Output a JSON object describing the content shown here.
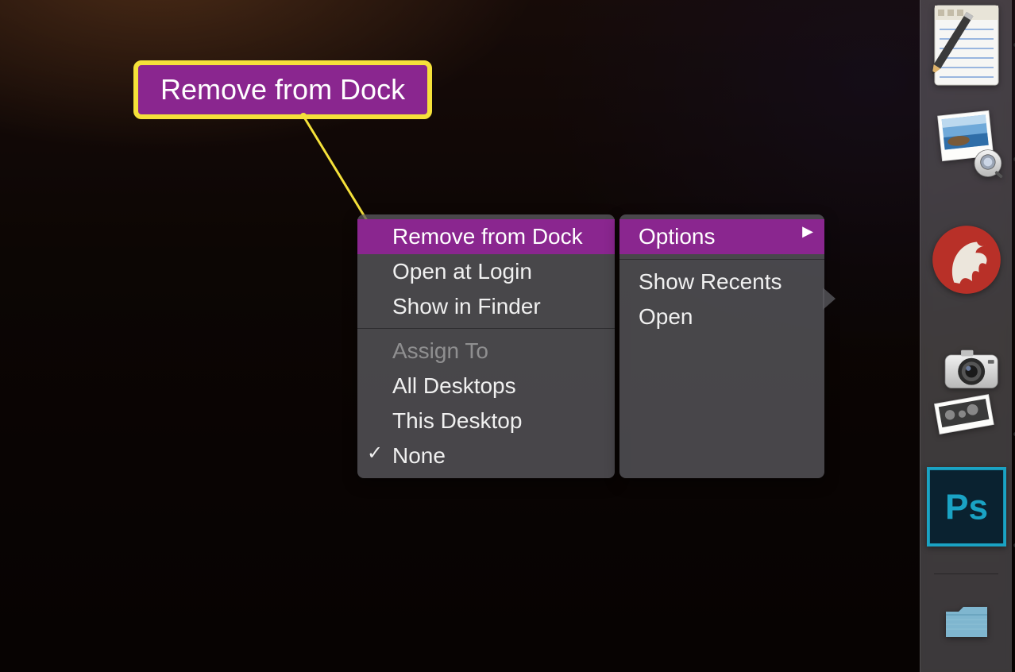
{
  "callout": {
    "label": "Remove from Dock"
  },
  "context_menu": {
    "level1": {
      "options_label": "Options",
      "items": [
        {
          "label": "Show Recents"
        },
        {
          "label": "Open"
        }
      ]
    },
    "level2": {
      "section1": [
        {
          "label": "Remove from Dock",
          "highlighted": true
        },
        {
          "label": "Open at Login"
        },
        {
          "label": "Show in Finder"
        }
      ],
      "section2_header": "Assign To",
      "section2": [
        {
          "label": "All Desktops"
        },
        {
          "label": "This Desktop"
        },
        {
          "label": "None",
          "checked": true
        }
      ]
    }
  },
  "dock": {
    "items": [
      {
        "name": "textedit-icon"
      },
      {
        "name": "preview-icon"
      },
      {
        "name": "bear-app-icon"
      },
      {
        "name": "image-capture-icon"
      },
      {
        "name": "photoshop-icon"
      },
      {
        "name": "downloads-folder-icon"
      }
    ]
  }
}
